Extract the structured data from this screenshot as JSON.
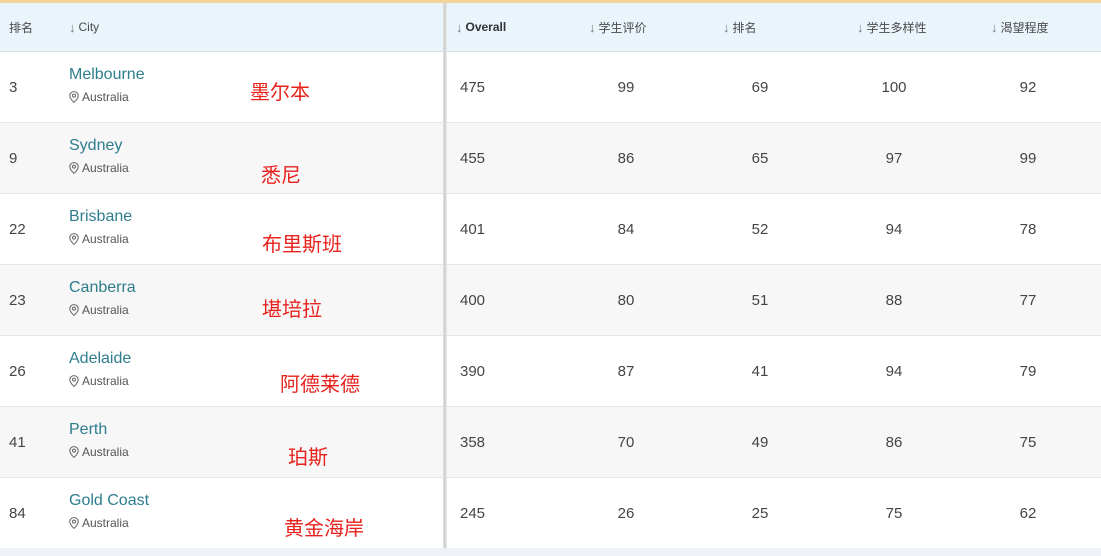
{
  "header": {
    "rank": "排名",
    "city": "City",
    "overall": "Overall",
    "student_review": "学生评价",
    "rank2": "排名",
    "diversity": "学生多样性",
    "desirability": "渴望程度"
  },
  "rows": [
    {
      "rank": "3",
      "city": "Melbourne",
      "country": "Australia",
      "cn": "墨尔本",
      "overall": "475",
      "review": "99",
      "rank2": "69",
      "diversity": "100",
      "desire": "92"
    },
    {
      "rank": "9",
      "city": "Sydney",
      "country": "Australia",
      "cn": "悉尼",
      "overall": "455",
      "review": "86",
      "rank2": "65",
      "diversity": "97",
      "desire": "99"
    },
    {
      "rank": "22",
      "city": "Brisbane",
      "country": "Australia",
      "cn": "布里斯班",
      "overall": "401",
      "review": "84",
      "rank2": "52",
      "diversity": "94",
      "desire": "78"
    },
    {
      "rank": "23",
      "city": "Canberra",
      "country": "Australia",
      "cn": "堪培拉",
      "overall": "400",
      "review": "80",
      "rank2": "51",
      "diversity": "88",
      "desire": "77"
    },
    {
      "rank": "26",
      "city": "Adelaide",
      "country": "Australia",
      "cn": "阿德莱德",
      "overall": "390",
      "review": "87",
      "rank2": "41",
      "diversity": "94",
      "desire": "79"
    },
    {
      "rank": "41",
      "city": "Perth",
      "country": "Australia",
      "cn": "珀斯",
      "overall": "358",
      "review": "70",
      "rank2": "49",
      "diversity": "86",
      "desire": "75"
    },
    {
      "rank": "84",
      "city": "Gold Coast",
      "country": "Australia",
      "cn": "黄金海岸",
      "overall": "245",
      "review": "26",
      "rank2": "25",
      "diversity": "75",
      "desire": "62"
    }
  ],
  "colors": {
    "header_bg": "#eaf4fb",
    "city_link": "#2e7d8c",
    "annotation_red": "#e8231e",
    "top_accent": "#f2d49a"
  }
}
